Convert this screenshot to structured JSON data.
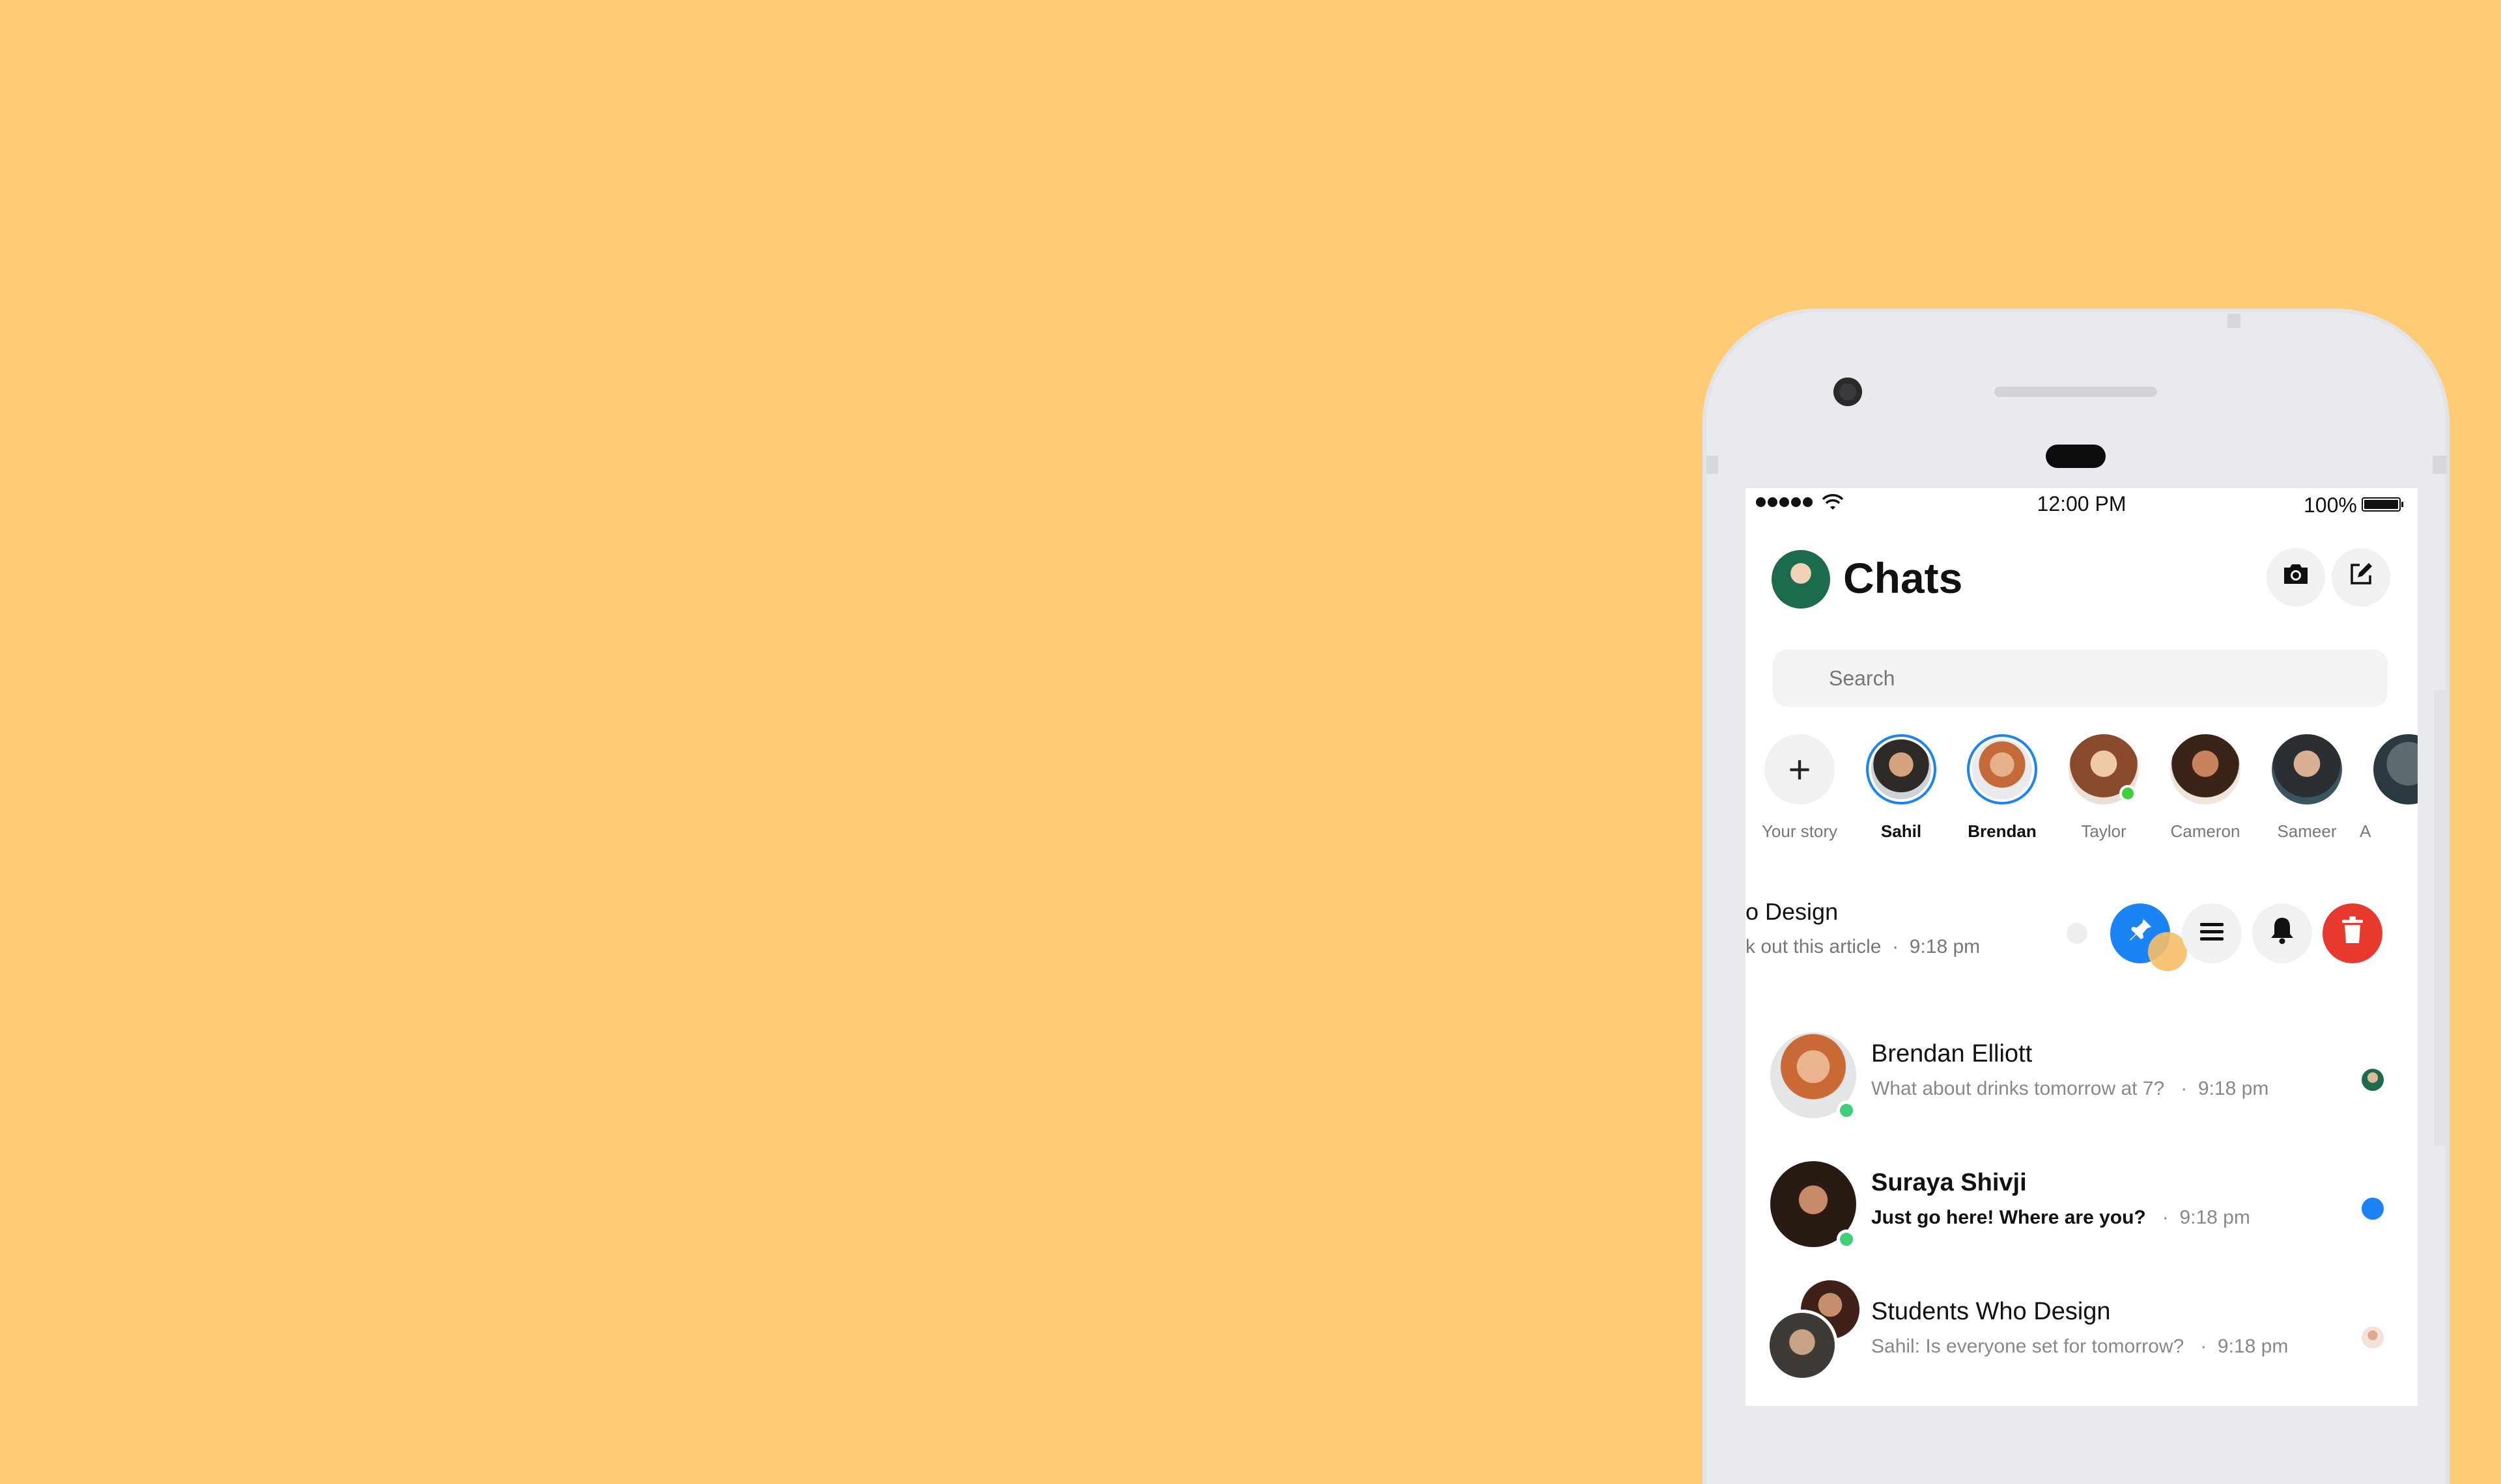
{
  "colors": {
    "background": "#FFCB75",
    "accent": "#1b84f5",
    "online": "#3fcf3f",
    "delete": "#e8392e"
  },
  "status_bar": {
    "time": "12:00 PM",
    "battery_pct": "100%"
  },
  "header": {
    "title": "Chats",
    "camera_icon": "camera-icon",
    "compose_icon": "compose-icon"
  },
  "search": {
    "placeholder": "Search"
  },
  "stories": [
    {
      "name": "Your story",
      "type": "add"
    },
    {
      "name": "Sahil",
      "active": true
    },
    {
      "name": "Brendan",
      "active": true
    },
    {
      "name": "Taylor",
      "online": true
    },
    {
      "name": "Cameron"
    },
    {
      "name": "Sameer"
    },
    {
      "name": "A"
    }
  ],
  "swiped_row": {
    "title": "o Design",
    "preview": "k out this article",
    "time": "9:18 pm",
    "actions": [
      "pin-icon",
      "menu-icon",
      "bell-icon",
      "trash-icon"
    ]
  },
  "chats": [
    {
      "name": "Brendan Elliott",
      "message": "What about drinks tomorrow at 7?",
      "time": "9:18 pm",
      "unread": false
    },
    {
      "name": "Suraya Shivji",
      "message": "Just go here! Where are you?",
      "time": "9:18 pm",
      "unread": true
    },
    {
      "name": "Students Who Design",
      "message": "Sahil: Is everyone set for tomorrow?",
      "time": "9:18 pm",
      "unread": false
    }
  ],
  "separator": "·"
}
